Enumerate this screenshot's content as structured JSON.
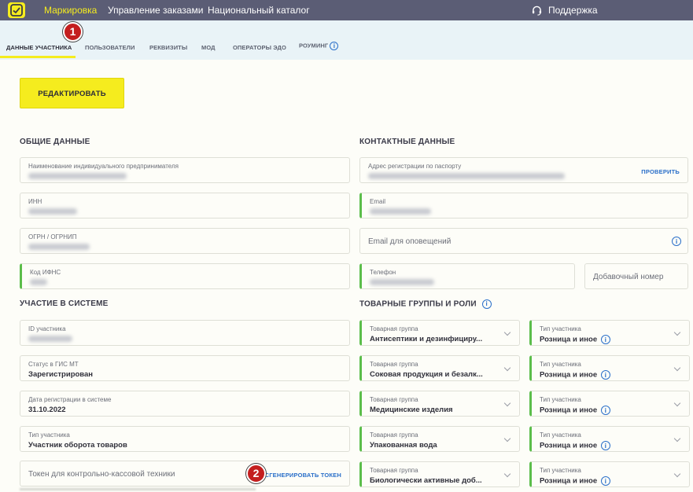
{
  "topbar": {
    "nav": [
      "Маркировка",
      "Управление заказами",
      "Национальный каталог"
    ],
    "support": "Поддержка"
  },
  "tabs": [
    "ДАННЫЕ УЧАСТНИКА",
    "ПОЛЬЗОВАТЕЛИ",
    "РЕКВИЗИТЫ",
    "МОД",
    "ОПЕРАТОРЫ ЭДО",
    "РОУМИНГ"
  ],
  "badges": [
    "1",
    "2"
  ],
  "edit_button": "РЕДАКТИРОВАТЬ",
  "general": {
    "title": "ОБЩИЕ ДАННЫЕ",
    "name_label": "Наименование индивидуального предпринимателя",
    "inn_label": "ИНН",
    "ogrn_label": "ОГРН / ОГРНИП",
    "ifns_label": "Код ИФНС"
  },
  "contacts": {
    "title": "КОНТАКТНЫЕ ДАННЫЕ",
    "address_label": "Адрес регистрации по паспорту",
    "check_link": "ПРОВЕРИТЬ",
    "email_label": "Email",
    "notify_placeholder": "Email для оповещений",
    "phone_label": "Телефон",
    "ext_placeholder": "Добавочный номер"
  },
  "system": {
    "title": "УЧАСТИЕ В СИСТЕМЕ",
    "id_label": "ID участника",
    "status_label": "Статус в ГИС МТ",
    "status_value": "Зарегистрирован",
    "date_label": "Дата регистрации в системе",
    "date_value": "31.10.2022",
    "type_label": "Тип участника",
    "type_value": "Участник оборота товаров",
    "token_placeholder": "Токен для контрольно-кассовой техники",
    "token_link": "СГЕНЕРИРОВАТЬ ТОКЕН"
  },
  "goods": {
    "title": "ТОВАРНЫЕ ГРУППЫ И РОЛИ",
    "group_label": "Товарная группа",
    "role_label": "Тип участника",
    "rows": [
      {
        "group": "Антисептики и дезинфициру...",
        "role": "Розница и иное"
      },
      {
        "group": "Соковая продукция и безалк...",
        "role": "Розница и иное"
      },
      {
        "group": "Медицинские изделия",
        "role": "Розница и иное"
      },
      {
        "group": "Упакованная вода",
        "role": "Розница и иное"
      },
      {
        "group": "Биологически активные доб...",
        "role": "Розница и иное"
      }
    ]
  },
  "icons": {
    "logo": "marking-logo-icon",
    "support": "headset-icon",
    "info": "info-icon",
    "chevron": "chevron-down-icon"
  },
  "colors": {
    "topbar": "#5b5d75",
    "accent_yellow": "#f5ec1e",
    "link_blue": "#2a6fc9",
    "valid_green": "#5bbd4a",
    "badge_red": "#c41e1e"
  }
}
